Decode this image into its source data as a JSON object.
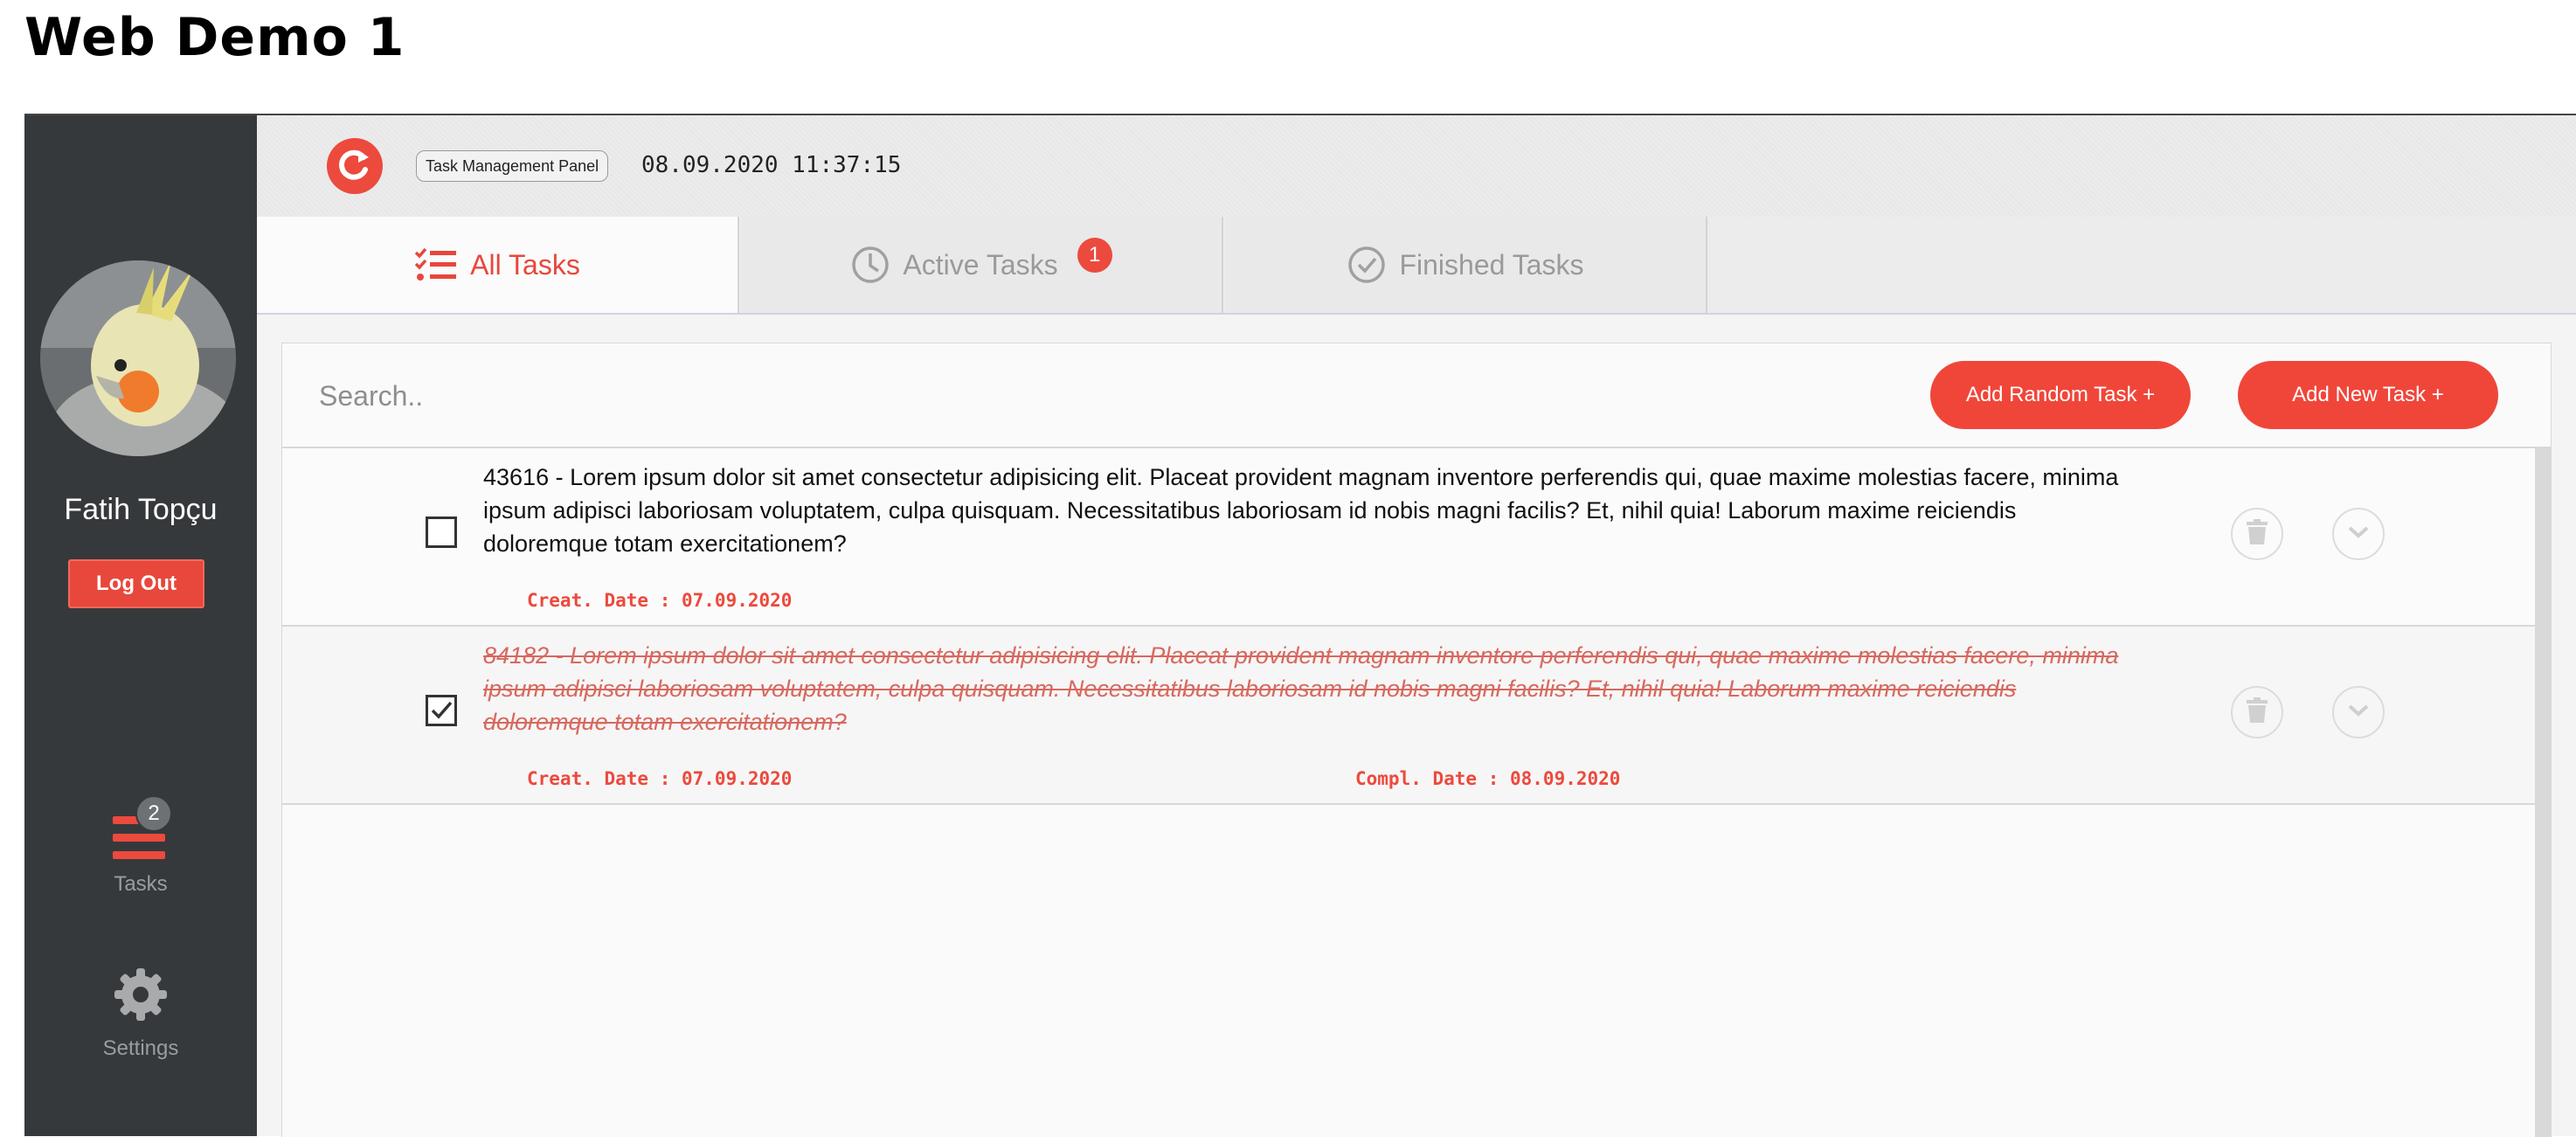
{
  "page": {
    "heading": "Web Demo 1"
  },
  "sidebar": {
    "user_name": "Fatih Topçu",
    "logout_label": "Log Out",
    "nav": [
      {
        "label": "Tasks",
        "icon": "menu-lines-icon",
        "badge": "2"
      },
      {
        "label": "Settings",
        "icon": "gear-icon"
      }
    ]
  },
  "topbar": {
    "panel_label": "Task Management Panel",
    "datetime": "08.09.2020 11:37:15",
    "refresh_icon": "refresh-icon"
  },
  "tabs": [
    {
      "label": "All Tasks",
      "icon": "checklist-icon",
      "active": true
    },
    {
      "label": "Active Tasks",
      "icon": "clock-icon",
      "badge": "1"
    },
    {
      "label": "Finished Tasks",
      "icon": "check-circle-icon"
    }
  ],
  "search": {
    "placeholder": "Search.."
  },
  "actions": {
    "add_random_label": "Add Random Task +",
    "add_new_label": "Add New Task +"
  },
  "tasks": [
    {
      "text": "43616 - Lorem ipsum dolor sit amet consectetur adipisicing elit. Placeat provident magnam inventore perferendis qui, quae maxime molestias facere, minima ipsum adipisci laboriosam voluptatem, culpa quisquam. Necessitatibus laboriosam id nobis magni facilis? Et, nihil quia! Laborum maxime reiciendis doloremque totam exercitationem?",
      "creat_date": "Creat. Date : 07.09.2020",
      "completed": false
    },
    {
      "text": "84182 - Lorem ipsum dolor sit amet consectetur adipisicing elit. Placeat provident magnam inventore perferendis qui, quae maxime molestias facere, minima ipsum adipisci laboriosam voluptatem, culpa quisquam. Necessitatibus laboriosam id nobis magni facilis? Et, nihil quia! Laborum maxime reiciendis doloremque totam exercitationem?",
      "creat_date": "Creat. Date : 07.09.2020",
      "compl_date": "Compl. Date : 08.09.2020",
      "completed": true
    }
  ],
  "colors": {
    "accent": "#ec4a3d",
    "sidebar_bg": "#36393c",
    "inactive_text": "#9a9a9a"
  }
}
